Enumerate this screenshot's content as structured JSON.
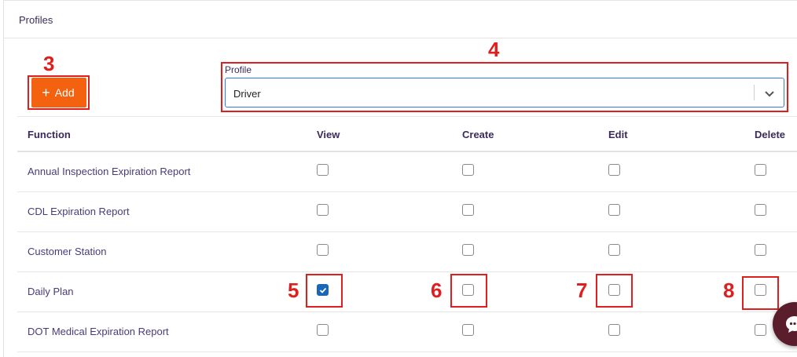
{
  "header": {
    "title": "Profiles"
  },
  "toolbar": {
    "add_label": "Add"
  },
  "profile": {
    "label": "Profile",
    "selected": "Driver"
  },
  "table": {
    "columns": [
      "Function",
      "View",
      "Create",
      "Edit",
      "Delete"
    ],
    "rows": [
      {
        "function": "Annual Inspection Expiration Report",
        "view": false,
        "create": false,
        "edit": false,
        "delete": false
      },
      {
        "function": "CDL Expiration Report",
        "view": false,
        "create": false,
        "edit": false,
        "delete": false
      },
      {
        "function": "Customer Station",
        "view": false,
        "create": false,
        "edit": false,
        "delete": false
      },
      {
        "function": "Daily Plan",
        "view": true,
        "create": false,
        "edit": false,
        "delete": false
      },
      {
        "function": "DOT Medical Expiration Report",
        "view": false,
        "create": false,
        "edit": false,
        "delete": false
      }
    ]
  },
  "annotations": {
    "n3": "3",
    "n4": "4",
    "n5": "5",
    "n6": "6",
    "n7": "7",
    "n8": "8"
  },
  "colors": {
    "accent": "#f5620f",
    "annotation": "#e01e1e",
    "checkbox_checked": "#1a66b8",
    "title_text": "#3b2b5a"
  },
  "icons": {
    "add": "plus-icon",
    "dropdown": "chevron-down-icon",
    "chat": "chat-icon",
    "check": "check-icon"
  }
}
